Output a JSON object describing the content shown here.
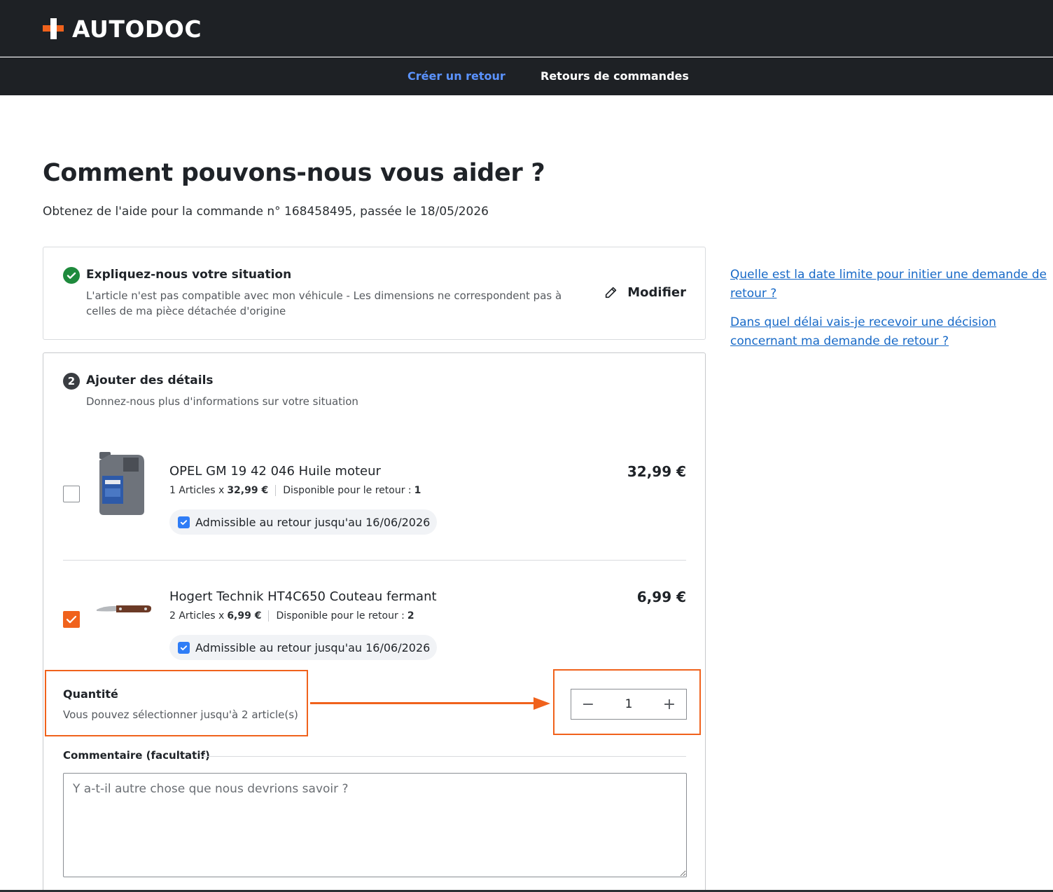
{
  "brand": {
    "name": "AUTODOC",
    "accent": "#f0621c",
    "link_color": "#1769c7"
  },
  "nav": {
    "items": [
      {
        "label": "Créer un retour",
        "active": true
      },
      {
        "label": "Retours de commandes",
        "active": false
      }
    ]
  },
  "page": {
    "title": "Comment pouvons-nous vous aider ?",
    "subtitle": "Obtenez de l'aide pour la commande n° 168458495, passée le 18/05/2026"
  },
  "step1": {
    "icon": "check-circle-icon",
    "title": "Expliquez-nous votre situation",
    "desc": "L'article n'est pas compatible avec mon véhicule - Les dimensions ne correspondent pas à celles de ma pièce détachée d'origine",
    "modify_label": "Modifier"
  },
  "step2": {
    "number": "2",
    "title": "Ajouter des détails",
    "desc": "Donnez-nous plus d'informations sur votre situation",
    "products": [
      {
        "name": "OPEL GM 19 42 046 Huile moteur",
        "qty_text": "1 Articles x",
        "unit_price": "32,99 €",
        "available_label": "Disponible pour le retour :",
        "available": "1",
        "price": "32,99 €",
        "badge": "Admissible au retour jusqu'au 16/06/2026",
        "checked": false
      },
      {
        "name": "Hogert Technik HT4C650 Couteau fermant",
        "qty_text": "2 Articles x",
        "unit_price": "6,99 €",
        "available_label": "Disponible pour le retour :",
        "available": "2",
        "price": "6,99 €",
        "badge": "Admissible au retour jusqu'au 16/06/2026",
        "checked": true
      }
    ],
    "quantity": {
      "label": "Quantité",
      "hint": "Vous pouvez sélectionner jusqu'à 2 article(s)",
      "value": "1",
      "minus": "−",
      "plus": "+"
    },
    "comment": {
      "label": "Commentaire (facultatif)",
      "placeholder": "Y a-t-il autre chose que nous devrions savoir ?"
    }
  },
  "faq": [
    "Quelle est la date limite pour initier une demande de retour ?",
    "Dans quel délai vais-je recevoir une décision concernant ma demande de retour ?"
  ]
}
